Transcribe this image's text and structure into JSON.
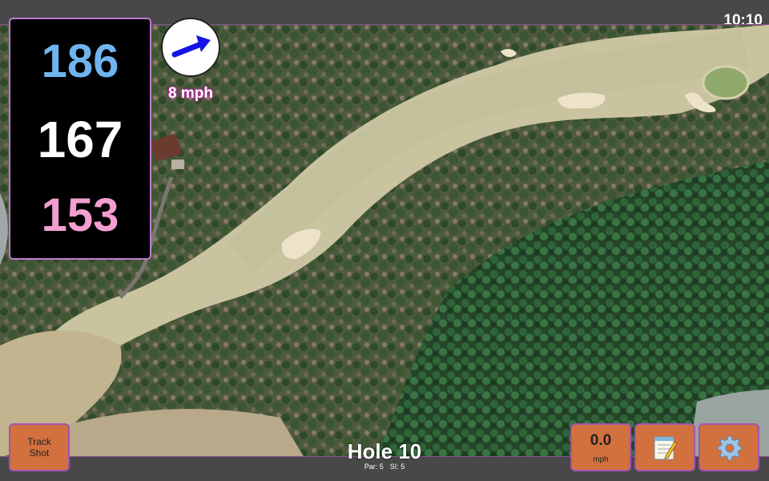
{
  "status_bar": {
    "time": "10:10"
  },
  "distances": {
    "back": "186",
    "middle": "167",
    "front": "153"
  },
  "wind": {
    "speed_label": "8 mph",
    "direction_icon": "wind-arrow-icon",
    "arrow_color": "#1414e6"
  },
  "buttons": {
    "track_shot_line1": "Track",
    "track_shot_line2": "Shot",
    "speed_value": "0.0",
    "speed_unit": "mph",
    "notes_icon": "notepad-icon",
    "settings_icon": "gear-icon"
  },
  "hole": {
    "title": "Hole 10",
    "par": "Par: 5",
    "si": "SI: 5"
  },
  "colors": {
    "back_distance": "#6fb4ee",
    "middle_distance": "#ffffff",
    "front_distance": "#f29ed0",
    "button_fill": "#d2703e",
    "accent_border": "#c07ad2"
  }
}
